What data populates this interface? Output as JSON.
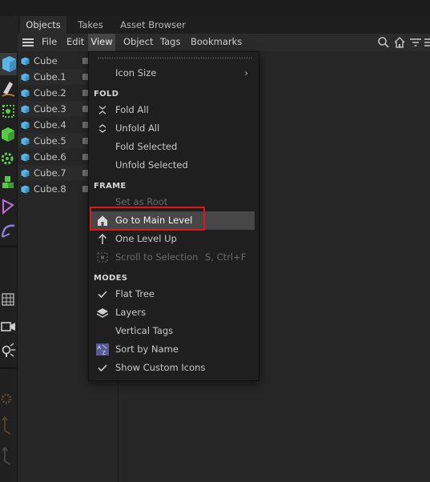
{
  "tabs": [
    "Objects",
    "Takes",
    "Asset Browser"
  ],
  "menubar": {
    "items": [
      "File",
      "Edit",
      "View",
      "Object",
      "Tags",
      "Bookmarks"
    ],
    "icons": [
      "search-icon",
      "home-icon",
      "filter-icon",
      "list-icon"
    ]
  },
  "objects": [
    "Cube",
    "Cube.1",
    "Cube.2",
    "Cube.3",
    "Cube.4",
    "Cube.5",
    "Cube.6",
    "Cube.7",
    "Cube.8"
  ],
  "view_menu": {
    "icon_size": "Icon Size",
    "fold": {
      "header": "FOLD",
      "fold_all": "Fold All",
      "unfold_all": "Unfold All",
      "fold_selected": "Fold Selected",
      "unfold_selected": "Unfold Selected"
    },
    "frame": {
      "header": "FRAME",
      "set_as_root": "Set as Root",
      "go_to_main_level": "Go to Main Level",
      "one_level_up": "One Level Up",
      "scroll_to_selection": "Scroll to Selection",
      "scroll_shortcut": "S, Ctrl+F"
    },
    "modes": {
      "header": "MODES",
      "flat_tree": "Flat Tree",
      "layers": "Layers",
      "vertical_tags": "Vertical Tags",
      "sort_by_name": "Sort by Name",
      "show_custom_icons": "Show Custom Icons"
    }
  },
  "colors": {
    "highlight": "#474747",
    "callout_border": "#e01515",
    "cube_icon": "#5ab4e6"
  }
}
